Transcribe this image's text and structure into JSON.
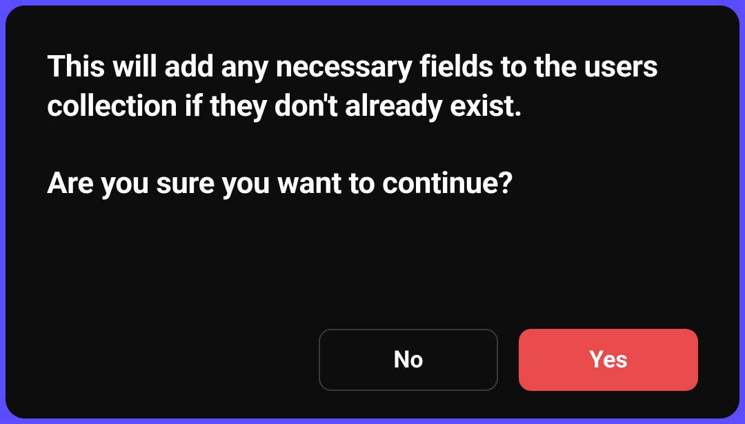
{
  "dialog": {
    "message_line1": "This will add any necessary fields to the users collection if they don't already exist.",
    "message_line2": "Are you sure you want to continue?",
    "actions": {
      "cancel_label": "No",
      "confirm_label": "Yes"
    }
  },
  "colors": {
    "border": "#5b4cff",
    "background": "#0d0d0d",
    "primary_button": "#e94b4b",
    "text": "#ffffff"
  }
}
